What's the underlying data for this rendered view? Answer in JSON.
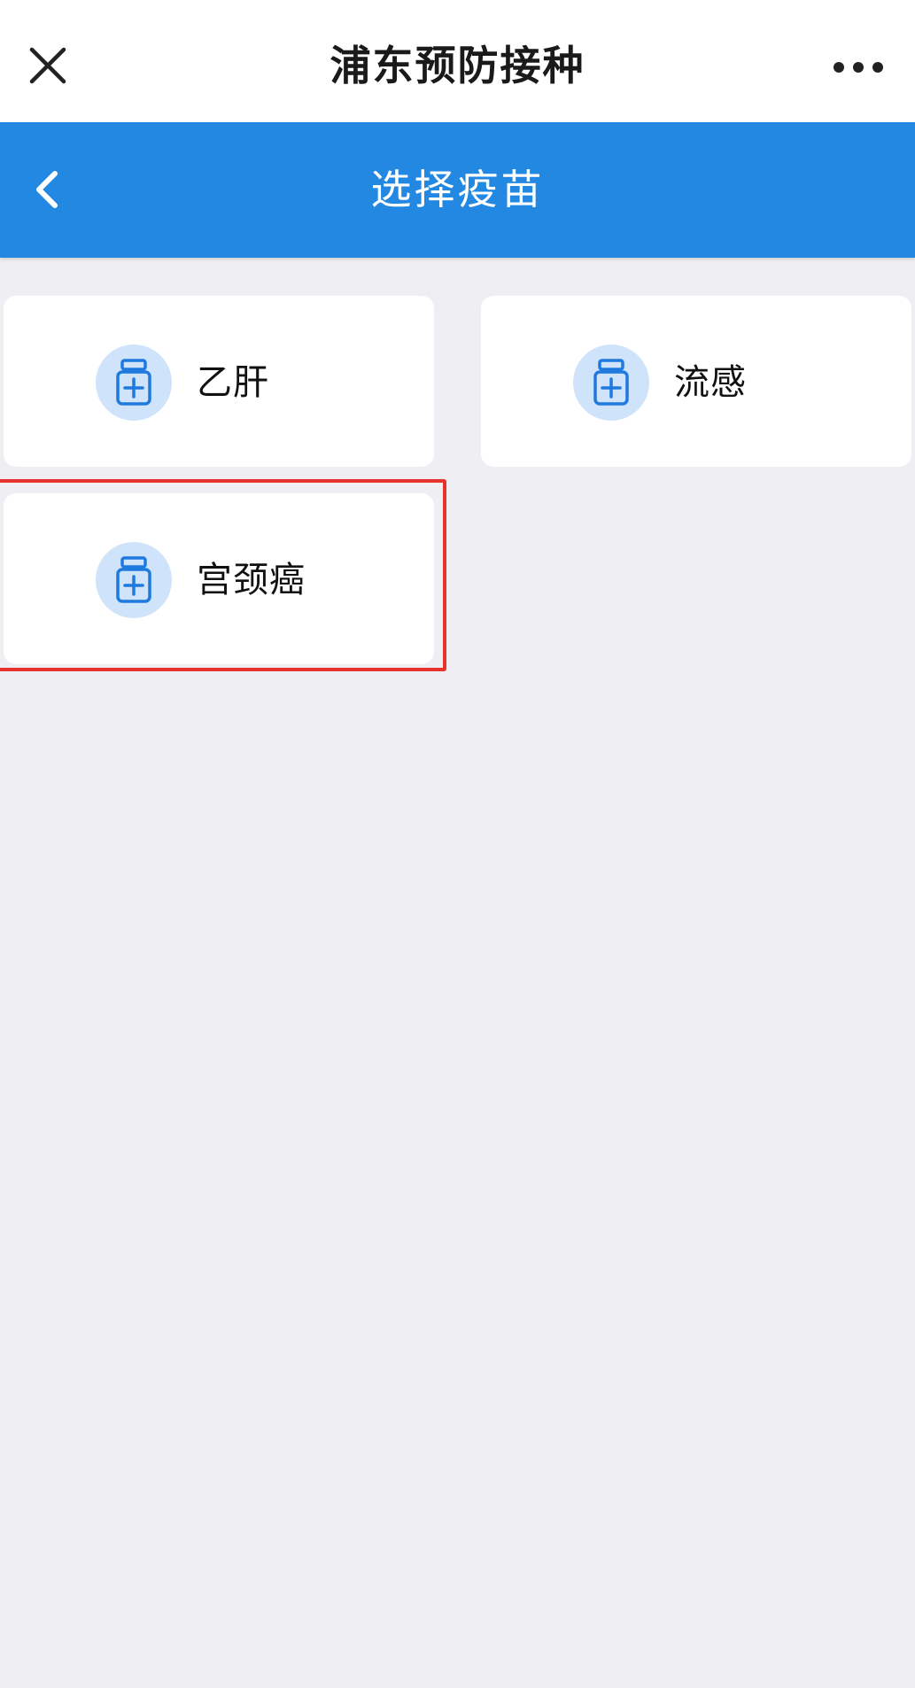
{
  "topbar": {
    "title": "浦东预防接种",
    "close_icon": "close-icon",
    "more_icon": "more-icon"
  },
  "navbar": {
    "title": "选择疫苗",
    "back_icon": "chevron-left-icon",
    "background": "#2388e2"
  },
  "vaccines": [
    {
      "label": "乙肝",
      "icon": "medicine-bottle-icon"
    },
    {
      "label": "流感",
      "icon": "medicine-bottle-icon"
    },
    {
      "label": "宫颈癌",
      "icon": "medicine-bottle-icon"
    }
  ],
  "colors": {
    "accent": "#2388e2",
    "icon_bg": "#cfe3fb",
    "icon_stroke": "#1f7ae0",
    "highlight": "#e8322d",
    "page_bg": "#eeeef3"
  }
}
